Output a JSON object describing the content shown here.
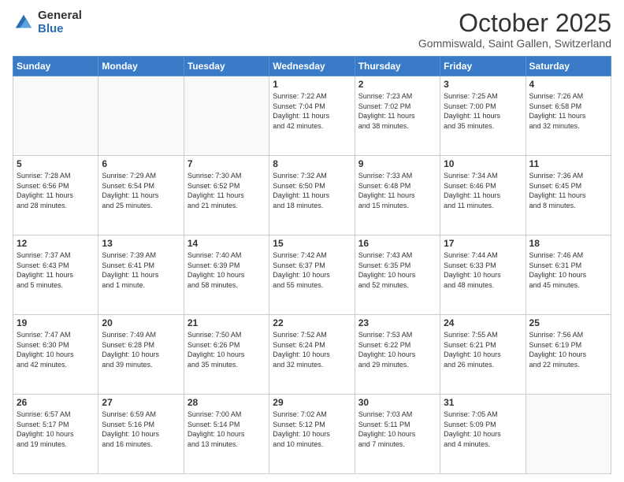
{
  "logo": {
    "general": "General",
    "blue": "Blue"
  },
  "title": {
    "month": "October 2025",
    "location": "Gommiswald, Saint Gallen, Switzerland"
  },
  "weekdays": [
    "Sunday",
    "Monday",
    "Tuesday",
    "Wednesday",
    "Thursday",
    "Friday",
    "Saturday"
  ],
  "weeks": [
    [
      {
        "day": "",
        "info": ""
      },
      {
        "day": "",
        "info": ""
      },
      {
        "day": "",
        "info": ""
      },
      {
        "day": "1",
        "info": "Sunrise: 7:22 AM\nSunset: 7:04 PM\nDaylight: 11 hours\nand 42 minutes."
      },
      {
        "day": "2",
        "info": "Sunrise: 7:23 AM\nSunset: 7:02 PM\nDaylight: 11 hours\nand 38 minutes."
      },
      {
        "day": "3",
        "info": "Sunrise: 7:25 AM\nSunset: 7:00 PM\nDaylight: 11 hours\nand 35 minutes."
      },
      {
        "day": "4",
        "info": "Sunrise: 7:26 AM\nSunset: 6:58 PM\nDaylight: 11 hours\nand 32 minutes."
      }
    ],
    [
      {
        "day": "5",
        "info": "Sunrise: 7:28 AM\nSunset: 6:56 PM\nDaylight: 11 hours\nand 28 minutes."
      },
      {
        "day": "6",
        "info": "Sunrise: 7:29 AM\nSunset: 6:54 PM\nDaylight: 11 hours\nand 25 minutes."
      },
      {
        "day": "7",
        "info": "Sunrise: 7:30 AM\nSunset: 6:52 PM\nDaylight: 11 hours\nand 21 minutes."
      },
      {
        "day": "8",
        "info": "Sunrise: 7:32 AM\nSunset: 6:50 PM\nDaylight: 11 hours\nand 18 minutes."
      },
      {
        "day": "9",
        "info": "Sunrise: 7:33 AM\nSunset: 6:48 PM\nDaylight: 11 hours\nand 15 minutes."
      },
      {
        "day": "10",
        "info": "Sunrise: 7:34 AM\nSunset: 6:46 PM\nDaylight: 11 hours\nand 11 minutes."
      },
      {
        "day": "11",
        "info": "Sunrise: 7:36 AM\nSunset: 6:45 PM\nDaylight: 11 hours\nand 8 minutes."
      }
    ],
    [
      {
        "day": "12",
        "info": "Sunrise: 7:37 AM\nSunset: 6:43 PM\nDaylight: 11 hours\nand 5 minutes."
      },
      {
        "day": "13",
        "info": "Sunrise: 7:39 AM\nSunset: 6:41 PM\nDaylight: 11 hours\nand 1 minute."
      },
      {
        "day": "14",
        "info": "Sunrise: 7:40 AM\nSunset: 6:39 PM\nDaylight: 10 hours\nand 58 minutes."
      },
      {
        "day": "15",
        "info": "Sunrise: 7:42 AM\nSunset: 6:37 PM\nDaylight: 10 hours\nand 55 minutes."
      },
      {
        "day": "16",
        "info": "Sunrise: 7:43 AM\nSunset: 6:35 PM\nDaylight: 10 hours\nand 52 minutes."
      },
      {
        "day": "17",
        "info": "Sunrise: 7:44 AM\nSunset: 6:33 PM\nDaylight: 10 hours\nand 48 minutes."
      },
      {
        "day": "18",
        "info": "Sunrise: 7:46 AM\nSunset: 6:31 PM\nDaylight: 10 hours\nand 45 minutes."
      }
    ],
    [
      {
        "day": "19",
        "info": "Sunrise: 7:47 AM\nSunset: 6:30 PM\nDaylight: 10 hours\nand 42 minutes."
      },
      {
        "day": "20",
        "info": "Sunrise: 7:49 AM\nSunset: 6:28 PM\nDaylight: 10 hours\nand 39 minutes."
      },
      {
        "day": "21",
        "info": "Sunrise: 7:50 AM\nSunset: 6:26 PM\nDaylight: 10 hours\nand 35 minutes."
      },
      {
        "day": "22",
        "info": "Sunrise: 7:52 AM\nSunset: 6:24 PM\nDaylight: 10 hours\nand 32 minutes."
      },
      {
        "day": "23",
        "info": "Sunrise: 7:53 AM\nSunset: 6:22 PM\nDaylight: 10 hours\nand 29 minutes."
      },
      {
        "day": "24",
        "info": "Sunrise: 7:55 AM\nSunset: 6:21 PM\nDaylight: 10 hours\nand 26 minutes."
      },
      {
        "day": "25",
        "info": "Sunrise: 7:56 AM\nSunset: 6:19 PM\nDaylight: 10 hours\nand 22 minutes."
      }
    ],
    [
      {
        "day": "26",
        "info": "Sunrise: 6:57 AM\nSunset: 5:17 PM\nDaylight: 10 hours\nand 19 minutes."
      },
      {
        "day": "27",
        "info": "Sunrise: 6:59 AM\nSunset: 5:16 PM\nDaylight: 10 hours\nand 16 minutes."
      },
      {
        "day": "28",
        "info": "Sunrise: 7:00 AM\nSunset: 5:14 PM\nDaylight: 10 hours\nand 13 minutes."
      },
      {
        "day": "29",
        "info": "Sunrise: 7:02 AM\nSunset: 5:12 PM\nDaylight: 10 hours\nand 10 minutes."
      },
      {
        "day": "30",
        "info": "Sunrise: 7:03 AM\nSunset: 5:11 PM\nDaylight: 10 hours\nand 7 minutes."
      },
      {
        "day": "31",
        "info": "Sunrise: 7:05 AM\nSunset: 5:09 PM\nDaylight: 10 hours\nand 4 minutes."
      },
      {
        "day": "",
        "info": ""
      }
    ]
  ]
}
